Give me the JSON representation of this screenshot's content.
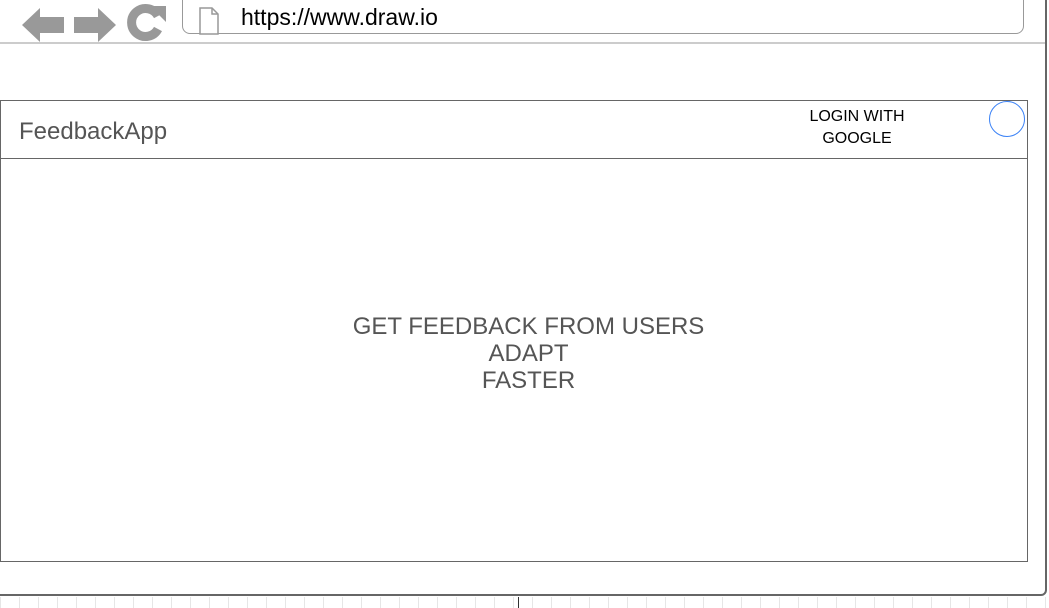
{
  "browser": {
    "url": "https://www.draw.io"
  },
  "icons": {
    "back": "arrow-left-icon",
    "forward": "arrow-right-icon",
    "reload": "reload-icon",
    "page": "page-icon"
  },
  "app": {
    "title": "FeedbackApp",
    "login_button": {
      "line1": "LOGIN WITH",
      "line2": "GOOGLE"
    },
    "hero": {
      "line1": "GET FEEDBACK FROM USERS",
      "line2": "ADAPT",
      "line3": "FASTER"
    }
  },
  "colors": {
    "frame": "#666666",
    "nav_icons": "#999999",
    "avatar_outline": "#3b82f6",
    "text_gray": "#555555"
  }
}
